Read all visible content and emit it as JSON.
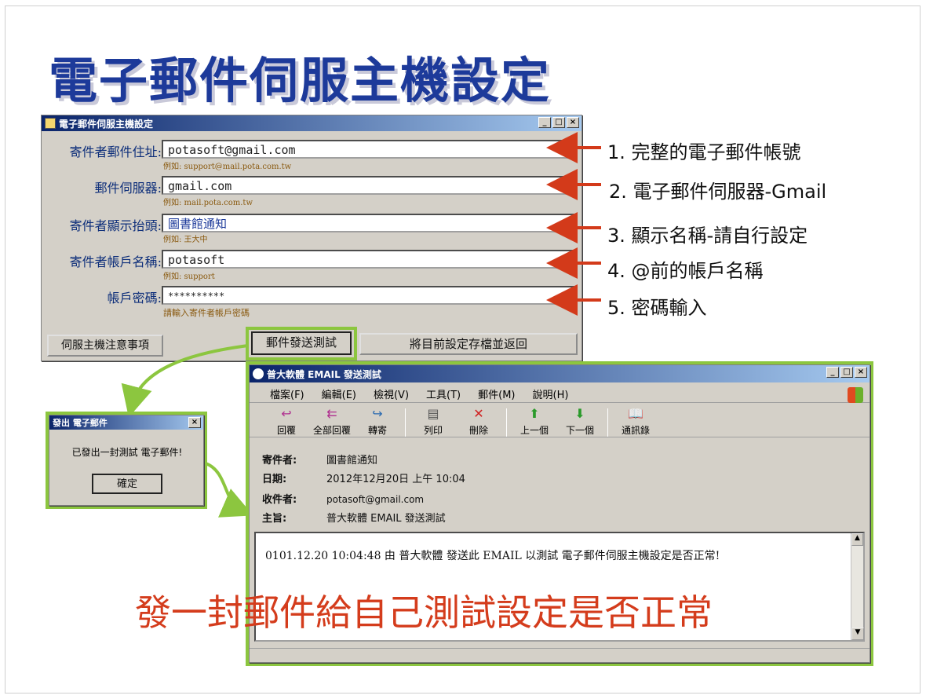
{
  "title": "電子郵件伺服主機設定",
  "settings_window": {
    "title": "電子郵件伺服主機設定",
    "buttons": [
      "_",
      "□",
      "×"
    ],
    "fields": [
      {
        "label": "寄件者郵件住址:",
        "value": "potasoft@gmail.com",
        "hint": "例如: support@mail.pota.com.tw"
      },
      {
        "label": "郵件伺服器:",
        "value": "gmail.com",
        "hint": "例如: mail.pota.com.tw"
      },
      {
        "label": "寄件者顯示抬頭:",
        "value": "圖書館通知",
        "hint": "例如: 王大中"
      },
      {
        "label": "寄件者帳戶名稱:",
        "value": "potasoft",
        "hint": "例如: support"
      },
      {
        "label": "帳戶密碼:",
        "value": "**********",
        "hint": "請輸入寄件者帳戶密碼"
      }
    ],
    "notes_button": "伺服主機注意事項",
    "test_button": "郵件發送測試",
    "save_button": "將目前設定存檔並返回"
  },
  "annotations": [
    "1. 完整的電子郵件帳號",
    "2. 電子郵件伺服器-Gmail",
    "3. 顯示名稱-請自行設定",
    "4. @前的帳戶名稱",
    "5. 密碼輸入"
  ],
  "sent_dialog": {
    "title": "發出 電子郵件",
    "message": "已發出一封測試 電子郵件!",
    "ok": "確定"
  },
  "mail_window": {
    "title": "普大軟體 EMAIL 發送測試",
    "menu": [
      "檔案(F)",
      "編輯(E)",
      "檢視(V)",
      "工具(T)",
      "郵件(M)",
      "說明(H)"
    ],
    "toolbar": [
      "回覆",
      "全部回覆",
      "轉寄",
      "列印",
      "刪除",
      "上一個",
      "下一個",
      "通訊錄"
    ],
    "header_labels": [
      "寄件者:",
      "日期:",
      "收件者:",
      "主旨:"
    ],
    "header_values": [
      "圖書館通知",
      "2012年12月20日 上午 10:04",
      "potasoft@gmail.com",
      "普大軟體 EMAIL 發送測試"
    ],
    "body": "0101.12.20 10:04:48 由 普大軟體 發送此 EMAIL 以測試 電子郵件伺服主機設定是否正常!"
  },
  "caption": "發一封郵件給自己測試設定是否正常",
  "colors": {
    "title": "#1d3a9a",
    "arrow": "#d33a1a",
    "highlight": "#8cc63f",
    "caption": "#d43c1c"
  }
}
